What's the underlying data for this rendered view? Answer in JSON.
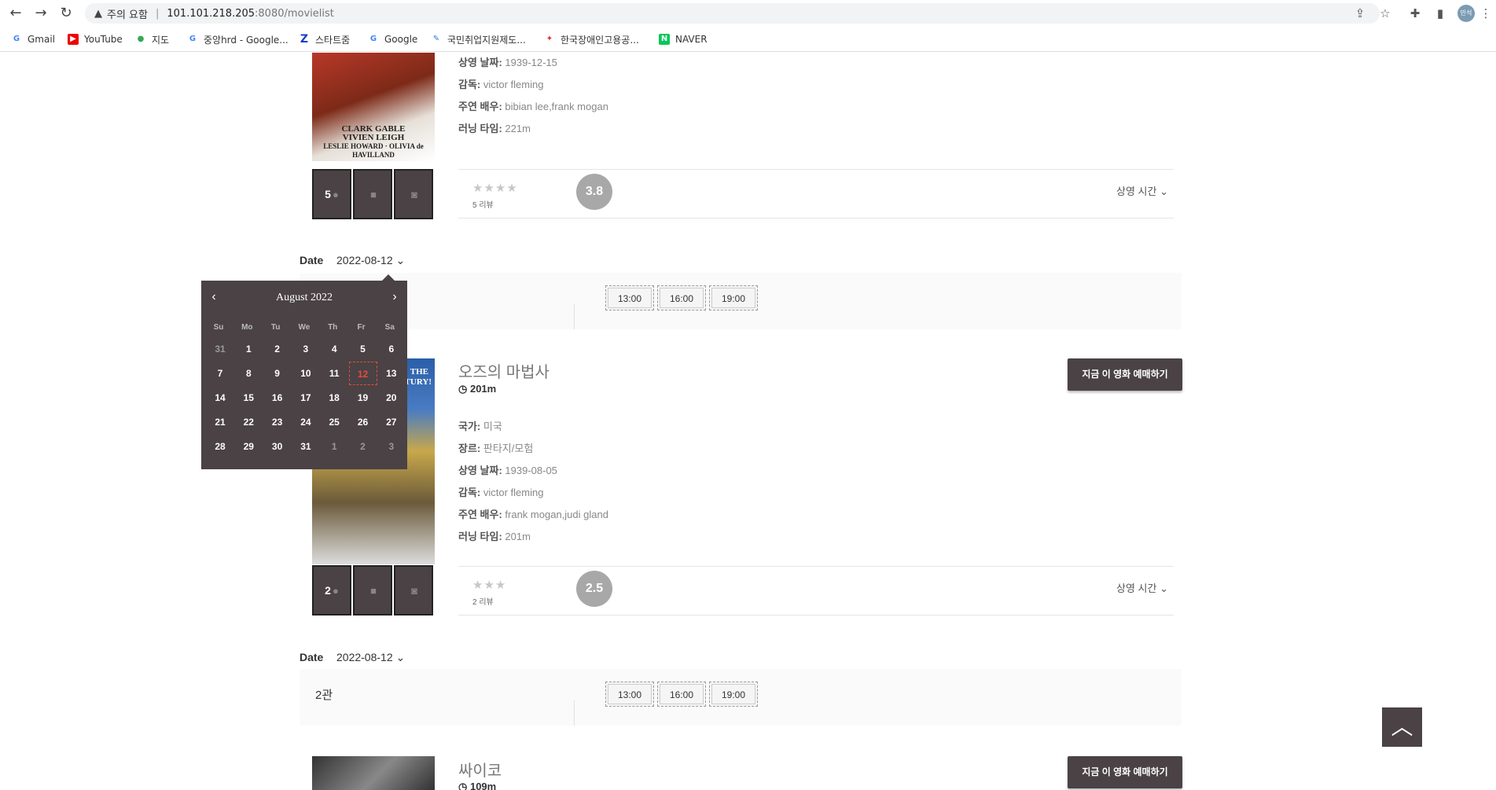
{
  "browser": {
    "warning": "주의 요함",
    "url_host": "101.101.218.205",
    "url_path": ":8080/movielist",
    "avatar": "민석"
  },
  "bookmarks": [
    "Gmail",
    "YouTube",
    "지도",
    "중앙hrd - Google...",
    "스타트줌",
    "Google",
    "국민취업지원제도...",
    "한국장애인고용공...",
    "NAVER"
  ],
  "movie1": {
    "poster_lines": [
      "CLARK GABLE",
      "VIVIEN LEIGH",
      "LESLIE HOWARD · OLIVIA de HAVILLAND"
    ],
    "release_label": "상영 날짜:",
    "release": "1939-12-15",
    "director_label": "감독:",
    "director": "victor fleming",
    "cast_label": "주연 배우:",
    "cast": "bibian lee,frank mogan",
    "runtime_label": "러닝 타임:",
    "runtime": "221m",
    "review_count": "5",
    "stars": "★★★★",
    "reviews_text": "5 리뷰",
    "score": "3.8",
    "showtime_label": "상영 시간",
    "date_label": "Date",
    "date": "2022-08-12",
    "times": [
      "13:00",
      "16:00",
      "19:00"
    ]
  },
  "movie2": {
    "title": "오즈의 마법사",
    "runtime_top": "201m",
    "book_label": "지금 이 영화 예매하기",
    "poster_lines": [
      "THE",
      "NTURY!"
    ],
    "country_label": "국가:",
    "country": "미국",
    "genre_label": "장르:",
    "genre": "판타지/모험",
    "release_label": "상영 날짜:",
    "release": "1939-08-05",
    "director_label": "감독:",
    "director": "victor fleming",
    "cast_label": "주연 배우:",
    "cast": "frank mogan,judi gland",
    "runtime_label": "러닝 타임:",
    "runtime": "201m",
    "review_count": "2",
    "stars": "★★★",
    "reviews_text": "2 리뷰",
    "score": "2.5",
    "showtime_label": "상영 시간",
    "date_label": "Date",
    "date": "2022-08-12",
    "hall": "2관",
    "times": [
      "13:00",
      "16:00",
      "19:00"
    ]
  },
  "movie3": {
    "title": "싸이코",
    "runtime_top": "109m",
    "book_label": "지금 이 영화 예매하기"
  },
  "calendar": {
    "title": "August 2022",
    "prev": "‹",
    "next": "›",
    "days_of_week": [
      "Su",
      "Mo",
      "Tu",
      "We",
      "Th",
      "Fr",
      "Sa"
    ],
    "weeks": [
      [
        "31",
        "1",
        "2",
        "3",
        "4",
        "5",
        "6"
      ],
      [
        "7",
        "8",
        "9",
        "10",
        "11",
        "12",
        "13"
      ],
      [
        "14",
        "15",
        "16",
        "17",
        "18",
        "19",
        "20"
      ],
      [
        "21",
        "22",
        "23",
        "24",
        "25",
        "26",
        "27"
      ],
      [
        "28",
        "29",
        "30",
        "31",
        "1",
        "2",
        "3"
      ]
    ],
    "selected": "12"
  },
  "scroll_top_icon": "arrow-up-icon"
}
